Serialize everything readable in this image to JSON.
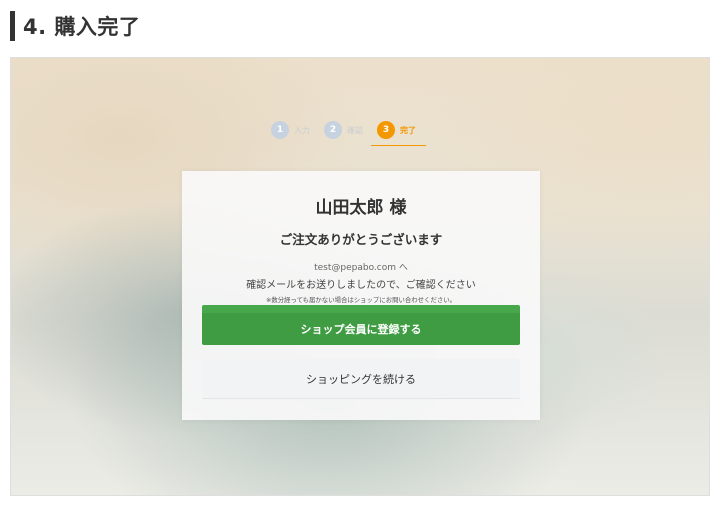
{
  "section": {
    "title": "4. 購入完了"
  },
  "steps": [
    {
      "number": "1",
      "label": "入力"
    },
    {
      "number": "2",
      "label": "確認"
    },
    {
      "number": "3",
      "label": "完了"
    }
  ],
  "card": {
    "customer": "山田太郎 様",
    "thanks": "ご注文ありがとうございます",
    "email": "test@pepabo.com へ",
    "confirm_message": "確認メールをお送りしましたので、ご確認ください",
    "note": "※数分経っても届かない場合はショップにお問い合わせください。",
    "register_button": "ショップ会員に登録する",
    "continue_button": "ショッピングを続ける"
  },
  "colors": {
    "accent_orange": "#f39800",
    "inactive_step": "#c6d2df",
    "register_green": "#3f9c43"
  }
}
